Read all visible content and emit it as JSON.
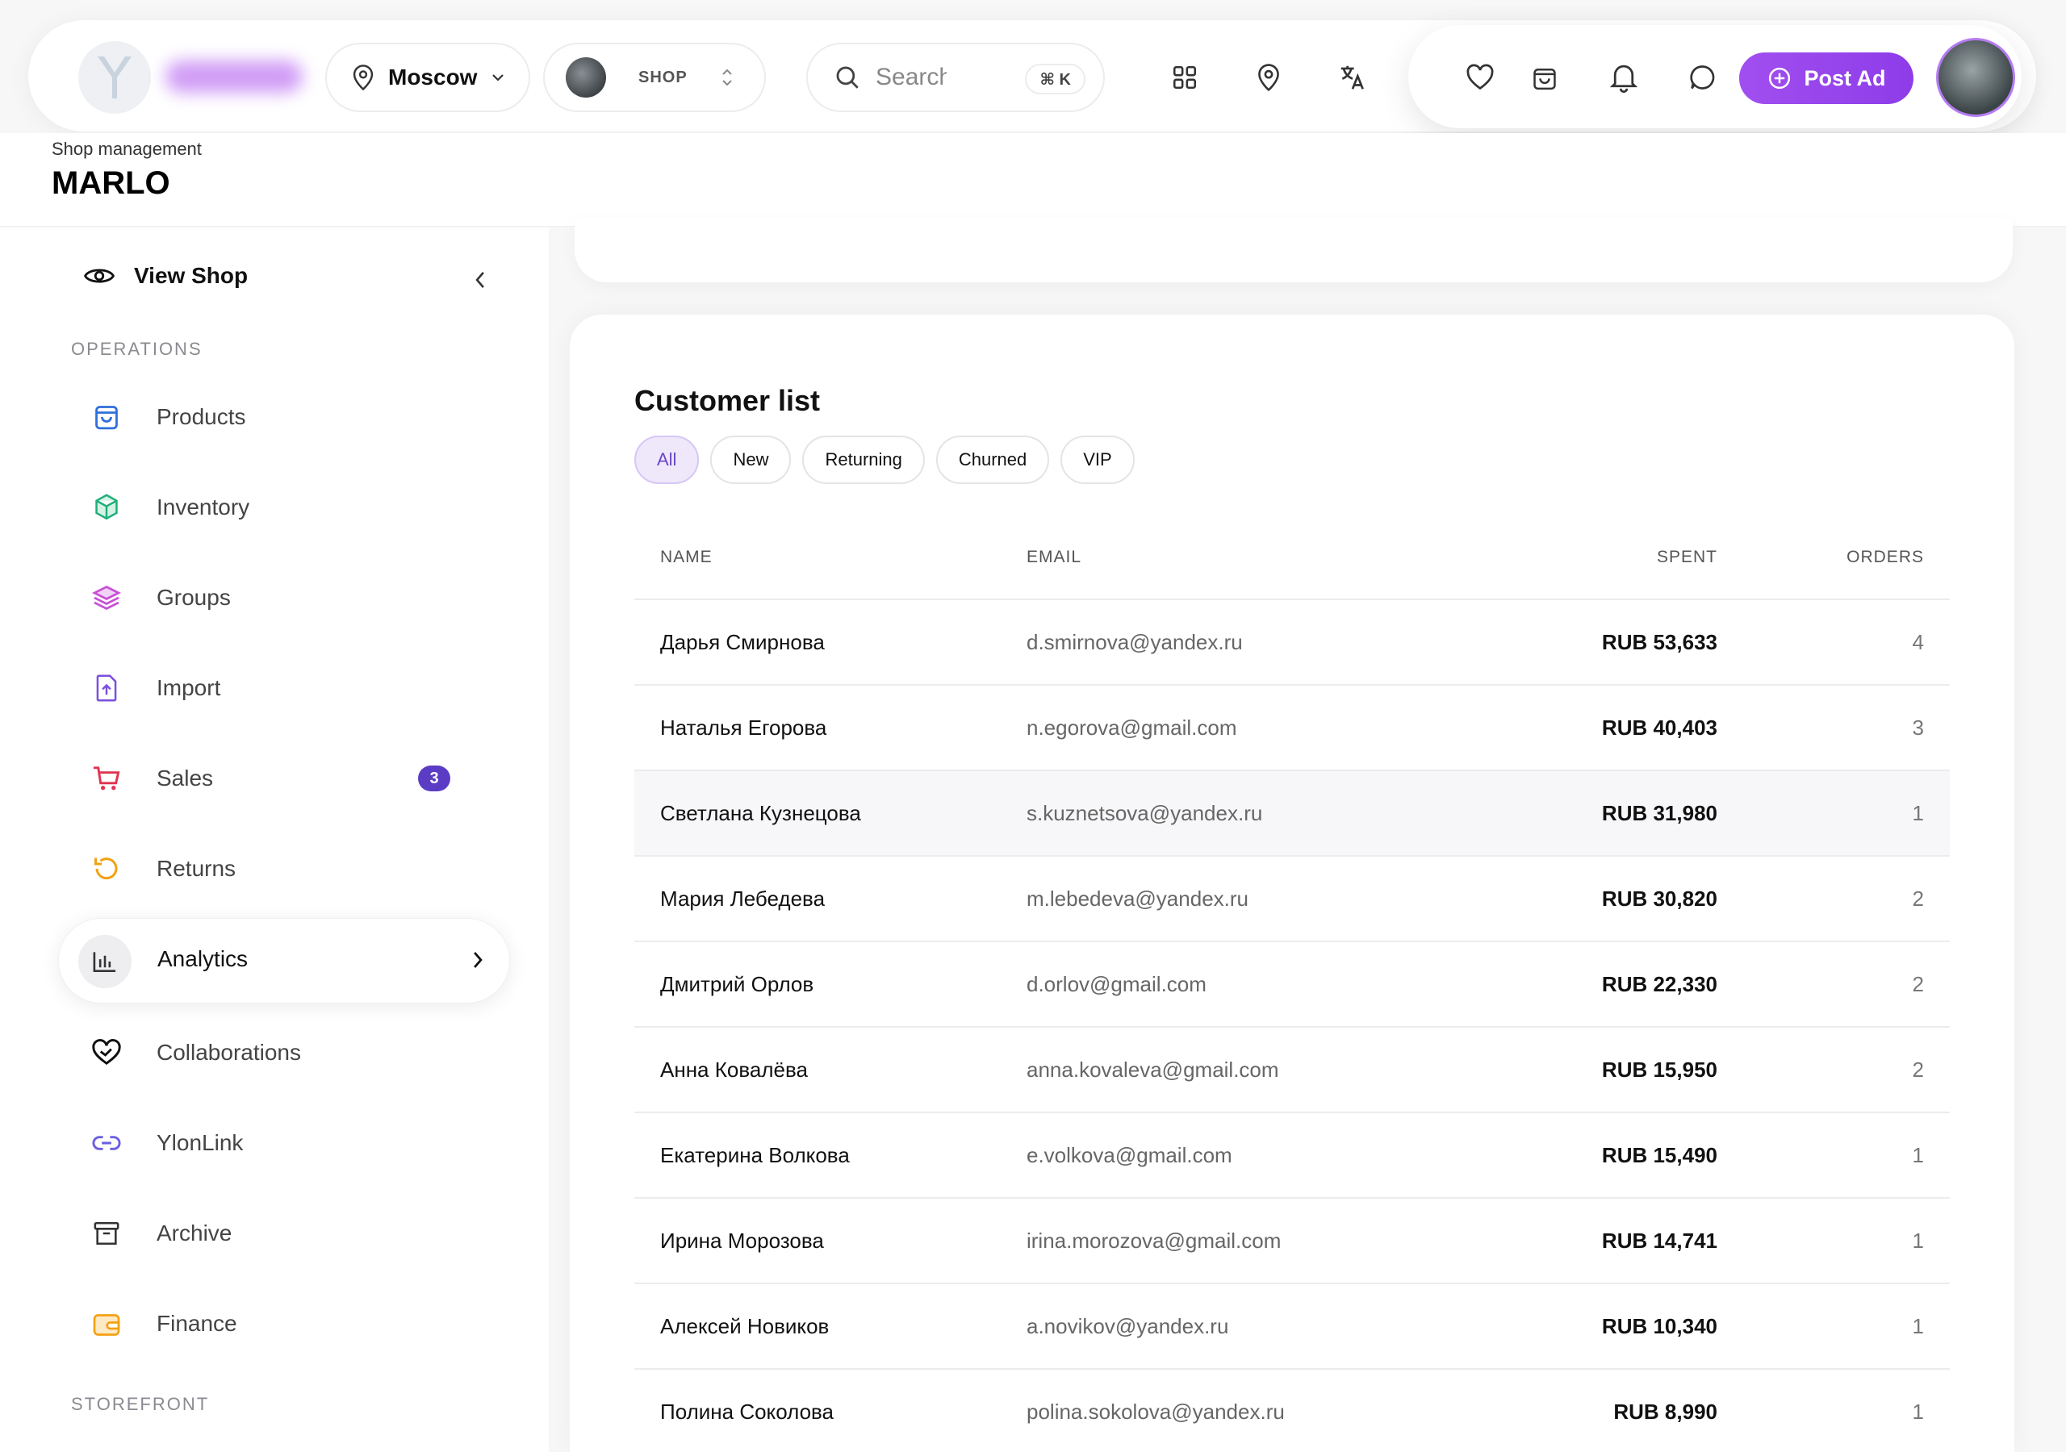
{
  "topbar": {
    "city": "Moscow",
    "shop_label": "SHOP",
    "search_placeholder": "Search",
    "search_shortcut": "⌘ K",
    "post_ad_label": "Post Ad"
  },
  "header": {
    "subtitle": "Shop management",
    "shop_name": "MARLO"
  },
  "sidebar": {
    "view_shop_label": "View Shop",
    "section_operations": "OPERATIONS",
    "section_storefront": "STOREFRONT",
    "items": [
      {
        "label": "Products",
        "icon": "shopping-bag-icon",
        "color": "#2f6fdb"
      },
      {
        "label": "Inventory",
        "icon": "cube-icon",
        "color": "#1fae7a"
      },
      {
        "label": "Groups",
        "icon": "layers-icon",
        "color": "#c94fd6"
      },
      {
        "label": "Import",
        "icon": "file-upload-icon",
        "color": "#7b4fe0"
      },
      {
        "label": "Sales",
        "icon": "cart-icon",
        "color": "#e0344f",
        "badge": "3"
      },
      {
        "label": "Returns",
        "icon": "rotate-icon",
        "color": "#f2a114"
      },
      {
        "label": "Analytics",
        "icon": "bar-chart-icon",
        "color": "#333333"
      },
      {
        "label": "Collaborations",
        "icon": "handshake-heart-icon",
        "color": "#111111"
      },
      {
        "label": "YlonLink",
        "icon": "link-icon",
        "color": "#6b5fe0"
      },
      {
        "label": "Archive",
        "icon": "archive-icon",
        "color": "#333333"
      },
      {
        "label": "Finance",
        "icon": "wallet-icon",
        "color": "#f2a114"
      }
    ]
  },
  "customers": {
    "title": "Customer list",
    "filters": [
      "All",
      "New",
      "Returning",
      "Churned",
      "VIP"
    ],
    "columns": [
      "NAME",
      "EMAIL",
      "SPENT",
      "ORDERS"
    ],
    "rows": [
      {
        "name": "Дарья Смирнова",
        "email": "d.smirnova@yandex.ru",
        "spent": "RUB 53,633",
        "orders": "4"
      },
      {
        "name": "Наталья Егорова",
        "email": "n.egorova@gmail.com",
        "spent": "RUB 40,403",
        "orders": "3"
      },
      {
        "name": "Светлана Кузнецова",
        "email": "s.kuznetsova@yandex.ru",
        "spent": "RUB 31,980",
        "orders": "1"
      },
      {
        "name": "Мария Лебедева",
        "email": "m.lebedeva@yandex.ru",
        "spent": "RUB 30,820",
        "orders": "2"
      },
      {
        "name": "Дмитрий Орлов",
        "email": "d.orlov@gmail.com",
        "spent": "RUB 22,330",
        "orders": "2"
      },
      {
        "name": "Анна Ковалёва",
        "email": "anna.kovaleva@gmail.com",
        "spent": "RUB 15,950",
        "orders": "2"
      },
      {
        "name": "Екатерина Волкова",
        "email": "e.volkova@gmail.com",
        "spent": "RUB 15,490",
        "orders": "1"
      },
      {
        "name": "Ирина Морозова",
        "email": "irina.morozova@gmail.com",
        "spent": "RUB 14,741",
        "orders": "1"
      },
      {
        "name": "Алексей Новиков",
        "email": "a.novikov@yandex.ru",
        "spent": "RUB 10,340",
        "orders": "1"
      },
      {
        "name": "Полина Соколова",
        "email": "polina.sokolova@yandex.ru",
        "spent": "RUB 8,990",
        "orders": "1"
      }
    ]
  }
}
